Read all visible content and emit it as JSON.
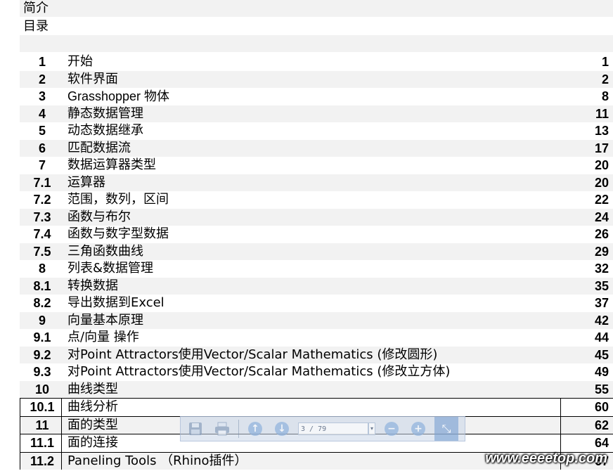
{
  "header": {
    "intro": "简介",
    "contents": "目录"
  },
  "toc": [
    {
      "num": "1",
      "title": "开始",
      "page": "1",
      "shade": false
    },
    {
      "num": "2",
      "title": "软件界面",
      "page": "2",
      "shade": true
    },
    {
      "num": "3",
      "title": "Grasshopper  物体",
      "page": "8",
      "shade": false,
      "latin": true
    },
    {
      "num": "4",
      "title": "静态数据管理",
      "page": "11",
      "shade": true
    },
    {
      "num": "5",
      "title": "动态数据继承",
      "page": "13",
      "shade": false
    },
    {
      "num": "6",
      "title": "匹配数据流",
      "page": "17",
      "shade": true
    },
    {
      "num": "7",
      "title": "数据运算器类型",
      "page": "20",
      "shade": false
    },
    {
      "num": "7.1",
      "title": "运算器",
      "page": "20",
      "shade": true
    },
    {
      "num": "7.2",
      "title": "范围，数列，区间",
      "page": "22",
      "shade": false
    },
    {
      "num": "7.3",
      "title": "函数与布尔",
      "page": "24",
      "shade": true
    },
    {
      "num": "7.4",
      "title": "函数与数字型数据",
      "page": "26",
      "shade": false
    },
    {
      "num": "7.5",
      "title": "三角函数曲线",
      "page": "29",
      "shade": true
    },
    {
      "num": "8",
      "title": "列表&数据管理",
      "page": "32",
      "shade": false
    },
    {
      "num": "8.1",
      "title": "转换数据",
      "page": "35",
      "shade": true
    },
    {
      "num": "8.2",
      "title": "导出数据到Excel",
      "page": "37",
      "shade": false
    },
    {
      "num": "9",
      "title": "向量基本原理",
      "page": "42",
      "shade": true
    },
    {
      "num": "9.1",
      "title": "点/向量 操作",
      "page": "44",
      "shade": false
    },
    {
      "num": "9.2",
      "title": "对Point Attractors使用Vector/Scalar Mathematics (修改圆形)",
      "page": "45",
      "shade": true
    },
    {
      "num": "9.3",
      "title": "对Point Attractors使用Vector/Scalar Mathematics (修改立方体)",
      "page": "49",
      "shade": false
    },
    {
      "num": "10",
      "title": "曲线类型",
      "page": "55",
      "shade": true
    },
    {
      "num": "10.1",
      "title": "曲线分析",
      "page": "60",
      "shade": false,
      "boxed": true
    },
    {
      "num": "11",
      "title": "面的类型",
      "page": "62",
      "shade": true,
      "boxed": true
    },
    {
      "num": "11.1",
      "title": "面的连接",
      "page": "64",
      "shade": false,
      "boxed": true
    },
    {
      "num": "11.2",
      "title": "Paneling Tools （Rhino插件）",
      "page": "67",
      "shade": true,
      "boxed": true
    }
  ],
  "toolbar": {
    "page_indicator": "3 / 79",
    "icons": [
      "save-icon",
      "print-icon",
      "page-up-icon",
      "page-down-icon",
      "zoom-out-icon",
      "zoom-in-icon",
      "collapse-icon"
    ]
  },
  "watermark": "www.eeeetop.com"
}
